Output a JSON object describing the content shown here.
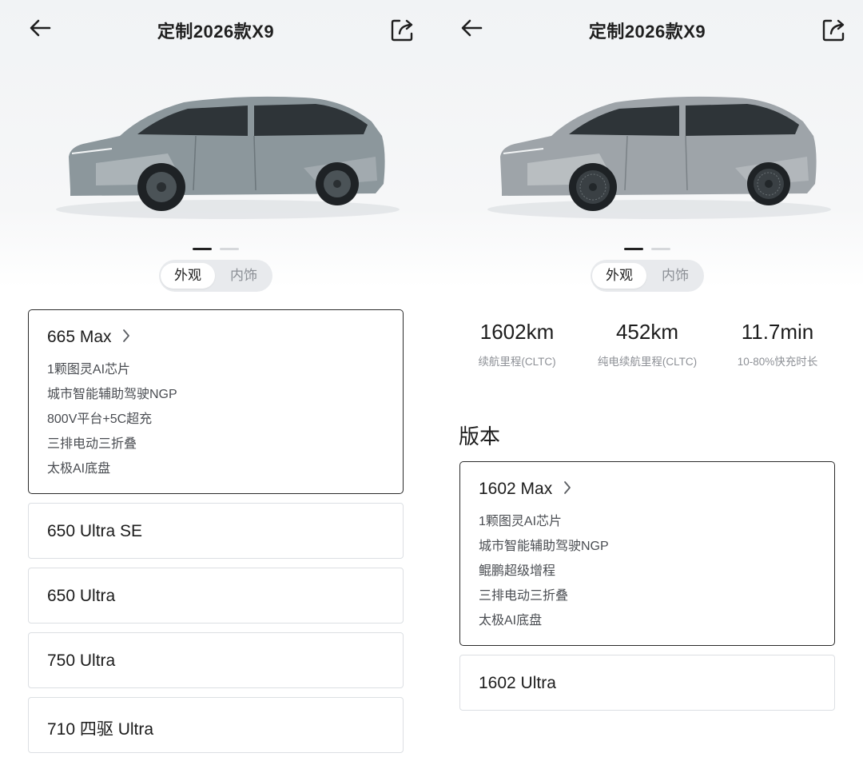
{
  "left": {
    "header": {
      "title": "定制2026款X9"
    },
    "view_tabs": [
      "外观",
      "内饰"
    ],
    "selected_version": {
      "name": "665 Max",
      "features": [
        "1颗图灵AI芯片",
        "城市智能辅助驾驶NGP",
        "800V平台+5C超充",
        "三排电动三折叠",
        "太极AI底盘"
      ]
    },
    "versions": [
      "650 Ultra SE",
      "650 Ultra",
      "750 Ultra",
      "710 四驱 Ultra"
    ]
  },
  "right": {
    "header": {
      "title": "定制2026款X9"
    },
    "view_tabs": [
      "外观",
      "内饰"
    ],
    "stats": [
      {
        "value": "1602km",
        "label": "续航里程(CLTC)"
      },
      {
        "value": "452km",
        "label": "纯电续航里程(CLTC)"
      },
      {
        "value": "11.7min",
        "label": "10-80%快充时长"
      }
    ],
    "section_title": "版本",
    "selected_version": {
      "name": "1602 Max",
      "features": [
        "1颗图灵AI芯片",
        "城市智能辅助驾驶NGP",
        "鲲鹏超级增程",
        "三排电动三折叠",
        "太极AI底盘"
      ]
    },
    "versions": [
      "1602 Ultra"
    ]
  },
  "icons": [
    "back-arrow-icon",
    "share-icon",
    "chevron-right-icon"
  ],
  "colors": {
    "car_left": "#8c979c",
    "car_right": "#9ea4a9",
    "selected_border": "#2a2a2a"
  }
}
